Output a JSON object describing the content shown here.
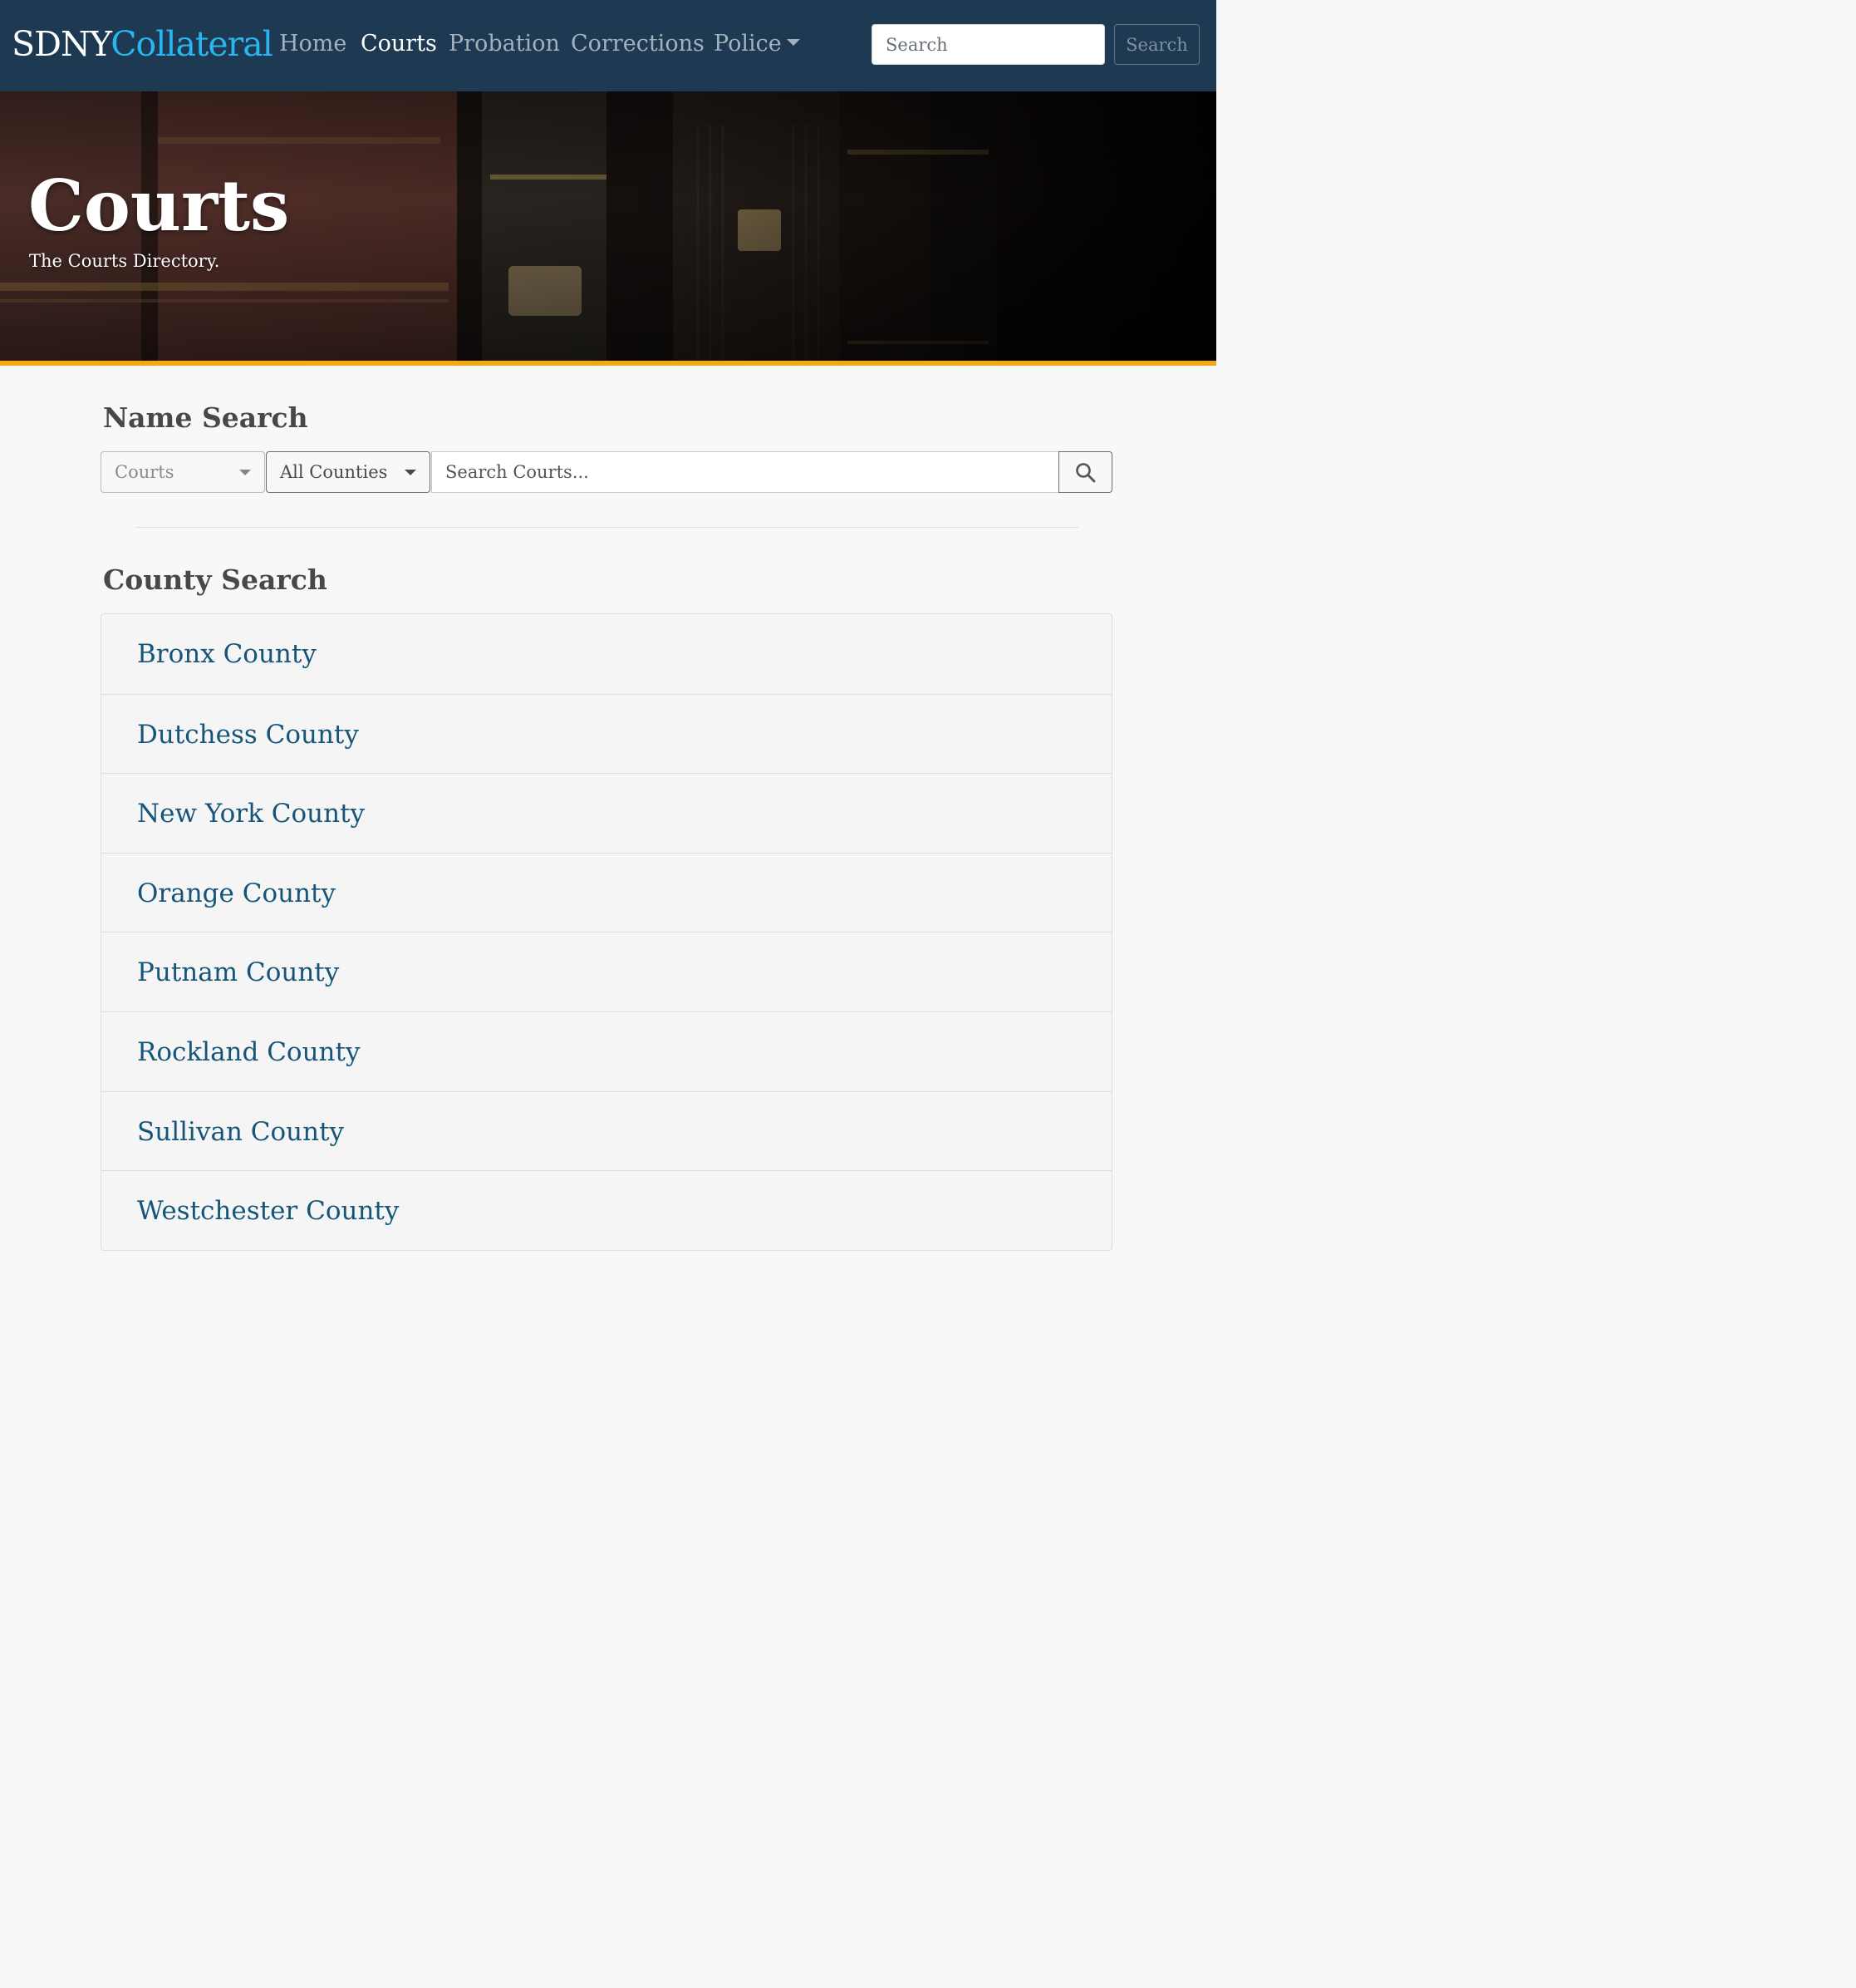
{
  "navbar": {
    "brand_part1": "SDNY",
    "brand_part2": "Collateral",
    "items": [
      {
        "label": "Home"
      },
      {
        "label": "Courts"
      },
      {
        "label": "Probation"
      },
      {
        "label": "Corrections"
      },
      {
        "label": "Police"
      }
    ],
    "search_placeholder": "Search",
    "search_button": "Search"
  },
  "hero": {
    "title": "Courts",
    "subtitle": "The Courts Directory."
  },
  "name_search": {
    "title": "Name Search",
    "category_select": "Courts",
    "county_select": "All Counties",
    "search_placeholder": "Search Courts..."
  },
  "county_search": {
    "title": "County Search",
    "counties": [
      "Bronx County",
      "Dutchess County",
      "New York County",
      "Orange County",
      "Putnam County",
      "Rockland County",
      "Sullivan County",
      "Westchester County"
    ]
  },
  "colors": {
    "navbar_bg": "#1e3a52",
    "brand_accent": "#29b6f0",
    "hero_accent": "#f4a814",
    "link": "#16557a"
  },
  "icons": {
    "search_button_icon": "search-icon",
    "dropdown_caret": "chevron-down-icon"
  }
}
